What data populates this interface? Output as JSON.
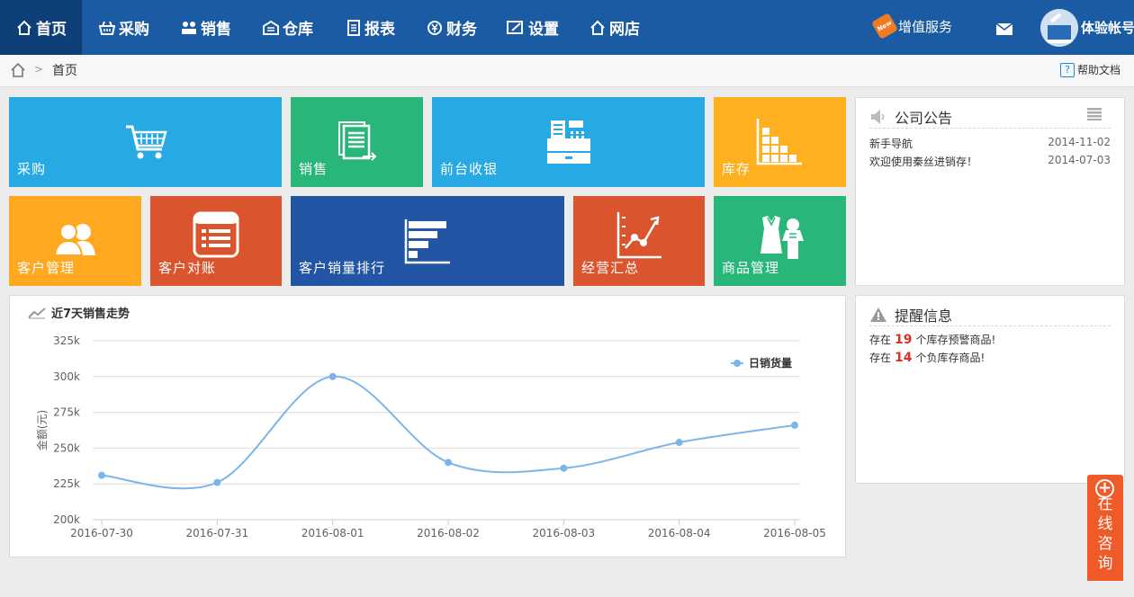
{
  "nav": {
    "items": [
      {
        "label": "首页",
        "icon": "home-icon",
        "active": true
      },
      {
        "label": "采购",
        "icon": "basket-icon"
      },
      {
        "label": "销售",
        "icon": "people-icon"
      },
      {
        "label": "仓库",
        "icon": "warehouse-icon"
      },
      {
        "label": "报表",
        "icon": "report-icon"
      },
      {
        "label": "财务",
        "icon": "finance-icon"
      },
      {
        "label": "设置",
        "icon": "settings-icon"
      },
      {
        "label": "网店",
        "icon": "store-icon"
      }
    ],
    "value_added": "增值服务",
    "new_tag": "New",
    "account": "体验帐号"
  },
  "breadcrumb": {
    "separator": ">",
    "current": "首页",
    "help": "帮助文档"
  },
  "tiles": [
    {
      "label": "采购",
      "color": "#27a9e3",
      "icon": "cart-icon"
    },
    {
      "label": "销售",
      "color": "#28b779",
      "icon": "sales-doc-icon"
    },
    {
      "label": "前台收银",
      "color": "#27a9e3",
      "icon": "cash-register-icon"
    },
    {
      "label": "库存",
      "color": "#ffb020",
      "icon": "inventory-icon"
    },
    {
      "label": "客户管理",
      "color": "#ffa820",
      "icon": "customers-icon"
    },
    {
      "label": "客户对账",
      "color": "#da542e",
      "icon": "reconcile-icon"
    },
    {
      "label": "客户销量排行",
      "color": "#2255a4",
      "icon": "ranking-bar-icon"
    },
    {
      "label": "经营汇总",
      "color": "#da542e",
      "icon": "trend-chart-icon"
    },
    {
      "label": "商品管理",
      "color": "#28b779",
      "icon": "clothes-icon"
    }
  ],
  "announcements": {
    "title": "公司公告",
    "items": [
      {
        "text": "新手导航",
        "date": "2014-11-02"
      },
      {
        "text": "欢迎使用秦丝进销存！",
        "date": "2014-07-03"
      }
    ]
  },
  "reminders": {
    "title": "提醒信息",
    "items": [
      {
        "prefix": "存在",
        "count": "19",
        "suffix": "个库存预警商品!"
      },
      {
        "prefix": "存在",
        "count": "14",
        "suffix": "个负库存商品!"
      }
    ]
  },
  "chart_title": "近7天销售走势",
  "consult": "在线咨询",
  "colors": {
    "nav": "#1a5ba4",
    "nav_active": "#0e3f78",
    "accent_red": "#d9302a",
    "line": "#7cb5ec"
  },
  "chart_data": {
    "type": "line",
    "title": "近7天销售走势",
    "ylabel": "金额(元)",
    "xlabel": "",
    "categories": [
      "2016-07-30",
      "2016-07-31",
      "2016-08-01",
      "2016-08-02",
      "2016-08-03",
      "2016-08-04",
      "2016-08-05"
    ],
    "series": [
      {
        "name": "日销货量",
        "values": [
          231000,
          226000,
          300000,
          240000,
          236000,
          254000,
          266000
        ]
      }
    ],
    "ylim": [
      200000,
      325000
    ],
    "yticks": [
      "200k",
      "225k",
      "250k",
      "275k",
      "300k",
      "325k"
    ],
    "grid": true,
    "legend": "top-right"
  }
}
